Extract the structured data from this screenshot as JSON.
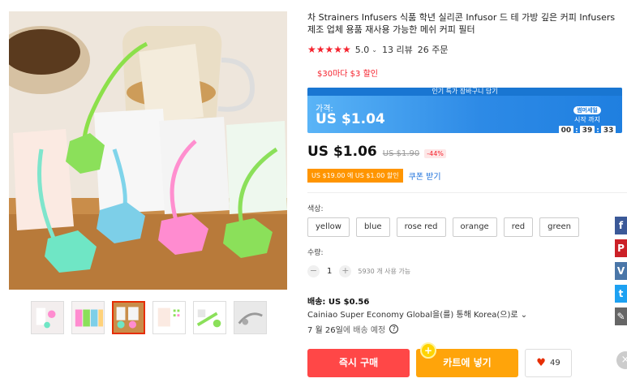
{
  "product": {
    "title": "차 Strainers Infusers 식품 학년 실리콘 Infusor 드 테 가방 깊은 커피 Infusers 제조 업체 용품 재사용 가능한 메쉬 커피 필터",
    "rating": "5.0",
    "reviews": "13 리뷰",
    "orders": "26 주문",
    "promo": "$30마다 $3 할인"
  },
  "flash_deal": {
    "banner": "인기 특가 장바구니 담기",
    "price_label": "가격:",
    "price": "US $1.04",
    "badge": "썸머세일",
    "sub": "시작 까지",
    "countdown": {
      "h": "00",
      "m": "39",
      "s": "33"
    }
  },
  "price": {
    "current": "US $1.06",
    "original": "US $1.90",
    "discount": "-44%"
  },
  "coupon": {
    "tag": "US $19.00 에 US $1.00 할인",
    "link": "쿠폰 받기"
  },
  "color": {
    "label": "색상:",
    "options": [
      "yellow",
      "blue",
      "rose red",
      "orange",
      "red",
      "green"
    ]
  },
  "quantity": {
    "label": "수량:",
    "value": "1",
    "available": "5930 개 사용 가능"
  },
  "shipping": {
    "title": "배송: US $0.56",
    "method": "Cainiao Super Economy Global을(를) 통해 Korea(으)로",
    "date_bold": "7 월 26일",
    "date_rest": "에 배송 예정"
  },
  "actions": {
    "buy": "즉시 구매",
    "cart": "카트에 넣기",
    "wish_count": "49"
  },
  "colors": {
    "accent_red": "#ff4747",
    "accent_orange": "#ffa40a",
    "flash_blue": "#2d8ae6"
  }
}
